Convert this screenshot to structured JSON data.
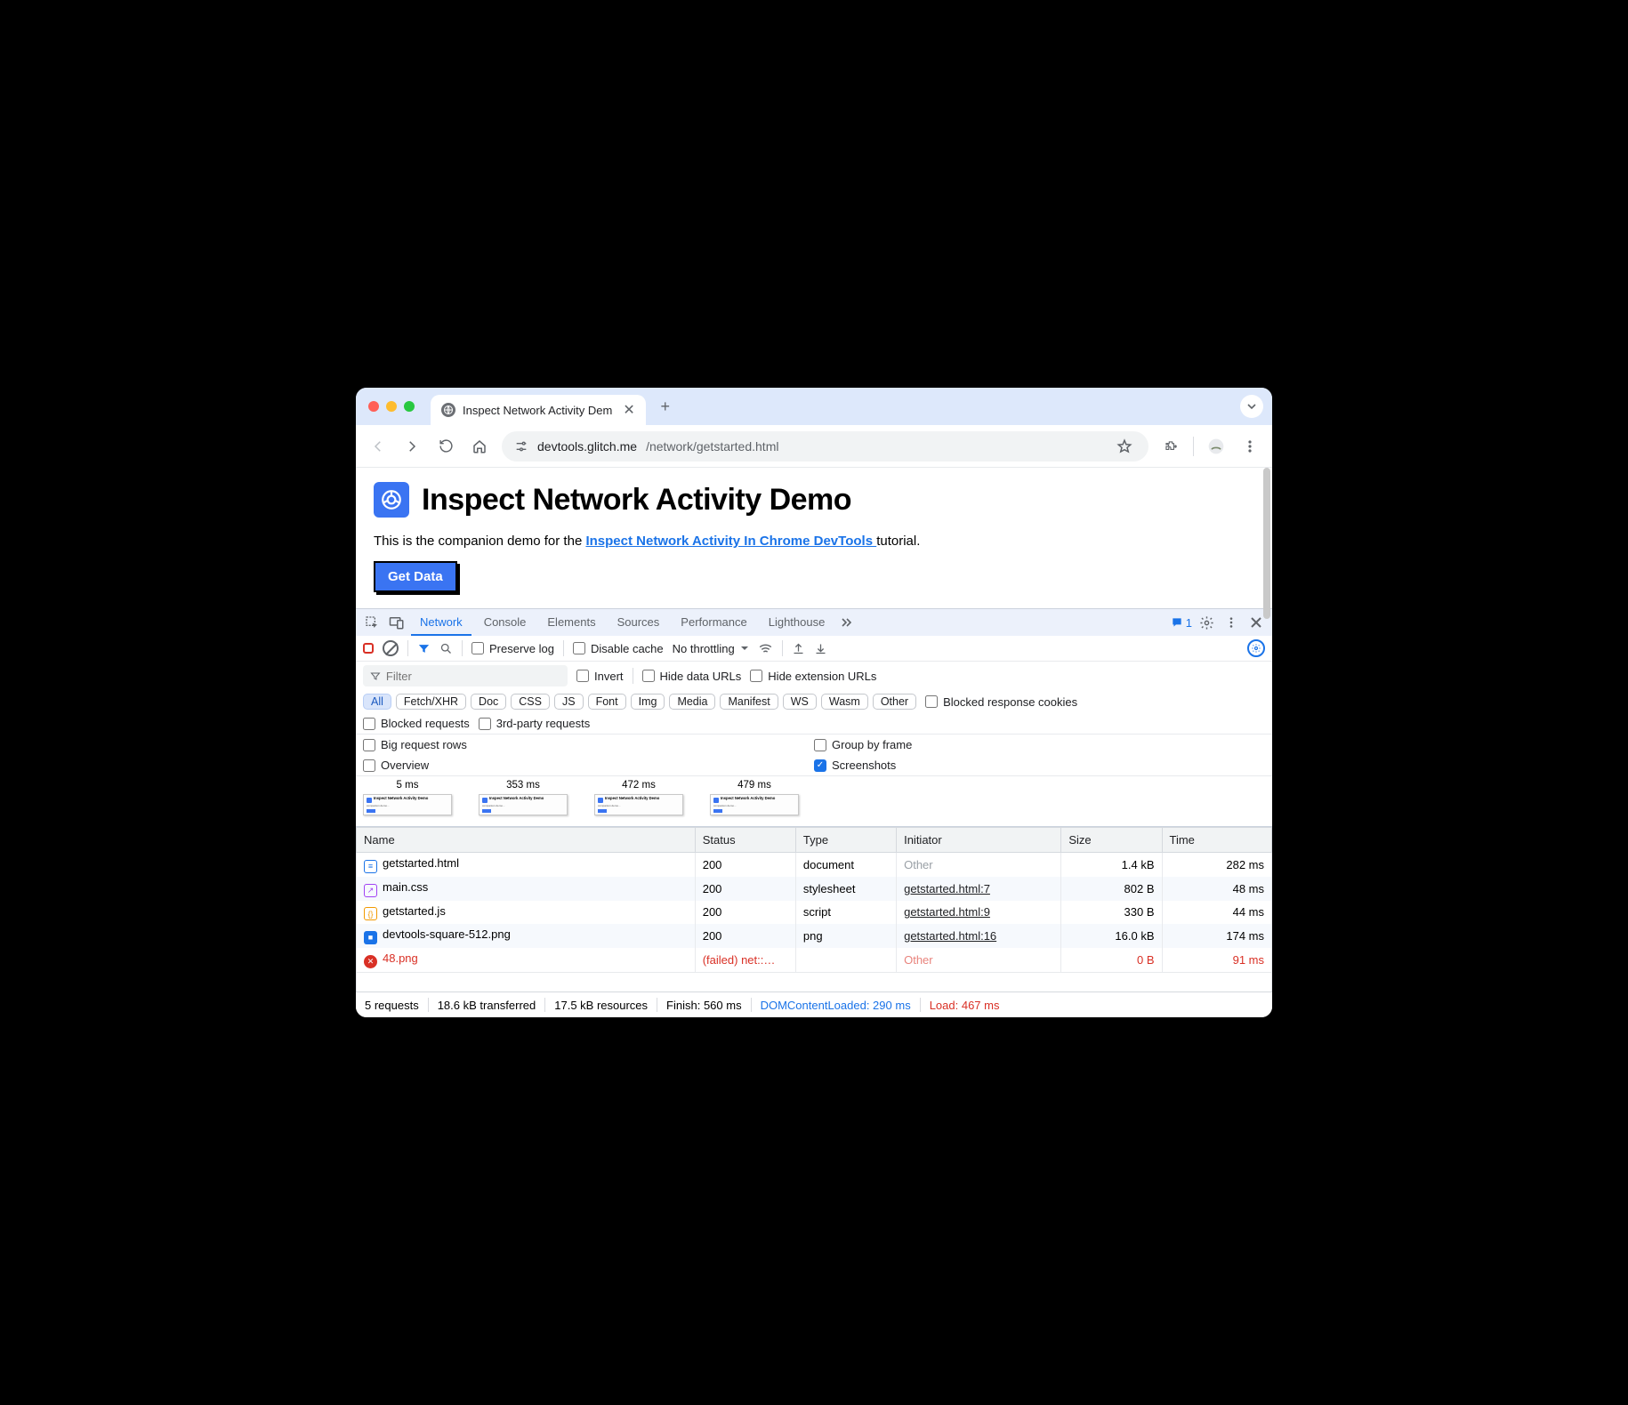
{
  "browser": {
    "tab_title": "Inspect Network Activity Dem",
    "url_host": "devtools.glitch.me",
    "url_path": "/network/getstarted.html"
  },
  "page": {
    "heading": "Inspect Network Activity Demo",
    "intro_prefix": "This is the companion demo for the ",
    "intro_link": "Inspect Network Activity In Chrome DevTools ",
    "intro_suffix": "tutorial.",
    "button": "Get Data"
  },
  "devtools": {
    "tabs": [
      "Network",
      "Console",
      "Elements",
      "Sources",
      "Performance",
      "Lighthouse"
    ],
    "active_tab": "Network",
    "issue_count": "1",
    "row1": {
      "preserve": "Preserve log",
      "disable_cache": "Disable cache",
      "throttling": "No throttling"
    },
    "row2": {
      "filter_placeholder": "Filter",
      "invert": "Invert",
      "hide_data": "Hide data URLs",
      "hide_ext": "Hide extension URLs"
    },
    "chips": [
      "All",
      "Fetch/XHR",
      "Doc",
      "CSS",
      "JS",
      "Font",
      "Img",
      "Media",
      "Manifest",
      "WS",
      "Wasm",
      "Other"
    ],
    "blocked_cookies": "Blocked response cookies",
    "row3": {
      "blocked_req": "Blocked requests",
      "third": "3rd-party requests"
    },
    "row4": {
      "big": "Big request rows",
      "group": "Group by frame"
    },
    "row5": {
      "overview": "Overview",
      "screenshots": "Screenshots"
    },
    "shots": [
      "5 ms",
      "353 ms",
      "472 ms",
      "479 ms"
    ],
    "columns": [
      "Name",
      "Status",
      "Type",
      "Initiator",
      "Size",
      "Time"
    ],
    "rows": [
      {
        "icon": "doc",
        "name": "getstarted.html",
        "status": "200",
        "type": "document",
        "initiator": "Other",
        "initiator_kind": "other",
        "size": "1.4 kB",
        "time": "282 ms",
        "fail": false
      },
      {
        "icon": "css",
        "name": "main.css",
        "status": "200",
        "type": "stylesheet",
        "initiator": "getstarted.html:7",
        "initiator_kind": "link",
        "size": "802 B",
        "time": "48 ms",
        "fail": false
      },
      {
        "icon": "js",
        "name": "getstarted.js",
        "status": "200",
        "type": "script",
        "initiator": "getstarted.html:9",
        "initiator_kind": "link",
        "size": "330 B",
        "time": "44 ms",
        "fail": false
      },
      {
        "icon": "img",
        "name": "devtools-square-512.png",
        "status": "200",
        "type": "png",
        "initiator": "getstarted.html:16",
        "initiator_kind": "link",
        "size": "16.0 kB",
        "time": "174 ms",
        "fail": false
      },
      {
        "icon": "err",
        "name": "48.png",
        "status": "(failed) net::…",
        "type": "",
        "initiator": "Other",
        "initiator_kind": "other",
        "size": "0 B",
        "time": "91 ms",
        "fail": true
      }
    ],
    "status": {
      "requests": "5 requests",
      "transferred": "18.6 kB transferred",
      "resources": "17.5 kB resources",
      "finish": "Finish: 560 ms",
      "dcl": "DOMContentLoaded: 290 ms",
      "load": "Load: 467 ms"
    }
  }
}
